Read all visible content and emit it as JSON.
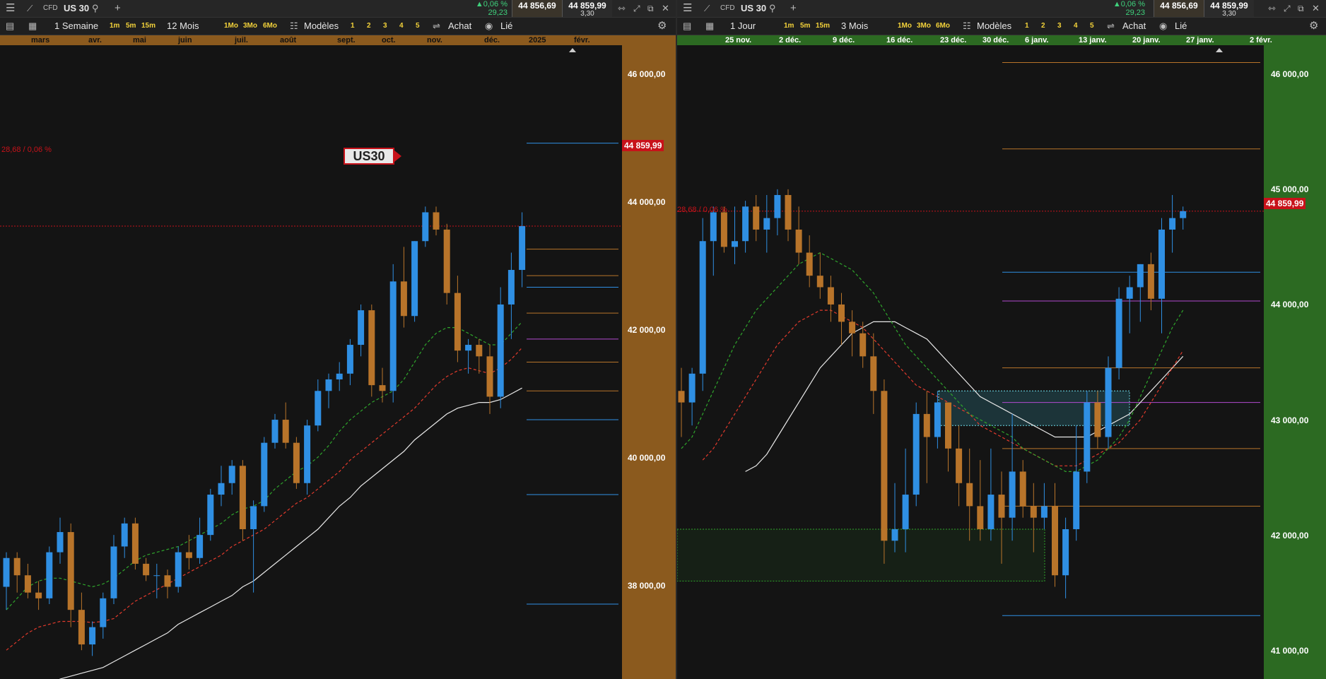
{
  "left": {
    "symbol": "US 30",
    "cfd": "CFD",
    "change_pct": "▲0,06 %",
    "change_abs": "29,23",
    "sell": "44 856,69",
    "buy": "44 859,99",
    "spread": "3,30",
    "toolbar": {
      "interval": "1 Semaine",
      "intervals": [
        "1m",
        "5m",
        "15m"
      ],
      "range": "12 Mois",
      "ranges": [
        "1Mo",
        "3Mo",
        "6Mo"
      ],
      "models": "Modèles",
      "presets": [
        "1",
        "2",
        "3",
        "4",
        "5"
      ],
      "buy_label": "Achat",
      "linked_label": "Lié"
    },
    "time_labels": [
      "mars",
      "avr.",
      "mai",
      "juin",
      "juil.",
      "août",
      "sept.",
      "oct.",
      "nov.",
      "déc.",
      "2025",
      "févr."
    ],
    "price_labels": [
      "46 000,00",
      "44 000,00",
      "42 000,00",
      "40 000,00",
      "38 000,00"
    ],
    "current_price_tag": "44 859,99",
    "change_line_text": "28,68 / 0,06 %",
    "symbol_tag": "US30",
    "axis_color": "#8b5a1e"
  },
  "right": {
    "symbol": "US 30",
    "cfd": "CFD",
    "change_pct": "▲0,06 %",
    "change_abs": "29,23",
    "sell": "44 856,69",
    "buy": "44 859,99",
    "spread": "3,30",
    "toolbar": {
      "interval": "1 Jour",
      "intervals": [
        "1m",
        "5m",
        "15m"
      ],
      "range": "3 Mois",
      "ranges": [
        "1Mo",
        "3Mo",
        "6Mo"
      ],
      "models": "Modèles",
      "presets": [
        "1",
        "2",
        "3",
        "4",
        "5"
      ],
      "buy_label": "Achat",
      "linked_label": "Lié"
    },
    "time_labels": [
      "25 nov.",
      "2 déc.",
      "9 déc.",
      "16 déc.",
      "23 déc.",
      "30 déc.",
      "6 janv.",
      "13 janv.",
      "20 janv.",
      "27 janv.",
      "2 févr."
    ],
    "price_labels": [
      "46 000,00",
      "45 000,00",
      "44 000,00",
      "43 000,00",
      "42 000,00",
      "41 000,00"
    ],
    "current_price_tag": "44 859,99",
    "change_line_text": "28,68 / 0,06 %",
    "axis_color": "#2c6a22"
  },
  "chart_data": [
    {
      "type": "candlestick",
      "interval": "weekly",
      "ylim": [
        37000,
        48000
      ],
      "up_color": "#2f8fe3",
      "down_color": "#b8742a",
      "candles": [
        [
          38600,
          39200,
          38200,
          39100
        ],
        [
          39100,
          39200,
          38500,
          38800
        ],
        [
          38800,
          39000,
          38400,
          38500
        ],
        [
          38500,
          38700,
          38200,
          38400
        ],
        [
          38400,
          39300,
          38300,
          39200
        ],
        [
          39200,
          39800,
          39000,
          39550
        ],
        [
          39550,
          39700,
          37900,
          38200
        ],
        [
          38200,
          38500,
          37500,
          37600
        ],
        [
          37600,
          38000,
          37400,
          37900
        ],
        [
          37900,
          38500,
          37700,
          38400
        ],
        [
          38400,
          39500,
          38300,
          39300
        ],
        [
          39300,
          39800,
          39100,
          39700
        ],
        [
          39700,
          39800,
          38900,
          39000
        ],
        [
          39000,
          39100,
          38700,
          38800
        ],
        [
          38800,
          39000,
          38400,
          38800
        ],
        [
          38800,
          38900,
          38400,
          38600
        ],
        [
          38600,
          39300,
          38500,
          39200
        ],
        [
          39200,
          39500,
          38900,
          39100
        ],
        [
          39100,
          39800,
          39000,
          39500
        ],
        [
          39500,
          40300,
          39400,
          40200
        ],
        [
          40200,
          40700,
          40000,
          40400
        ],
        [
          40400,
          40800,
          40200,
          40700
        ],
        [
          40700,
          40800,
          39400,
          39600
        ],
        [
          39600,
          40100,
          38500,
          40000
        ],
        [
          40000,
          41200,
          39900,
          41100
        ],
        [
          41100,
          41600,
          41000,
          41500
        ],
        [
          41500,
          41800,
          41000,
          41100
        ],
        [
          41100,
          41200,
          40300,
          40400
        ],
        [
          40400,
          41500,
          40200,
          41400
        ],
        [
          41400,
          42200,
          41300,
          42000
        ],
        [
          42000,
          42300,
          41700,
          42200
        ],
        [
          42200,
          42500,
          42000,
          42300
        ],
        [
          42300,
          42900,
          42100,
          42800
        ],
        [
          42800,
          43500,
          42600,
          43400
        ],
        [
          43400,
          43500,
          41900,
          42100
        ],
        [
          42100,
          42400,
          41800,
          42000
        ],
        [
          42000,
          44200,
          41800,
          43900
        ],
        [
          43900,
          44500,
          43100,
          43300
        ],
        [
          43300,
          44600,
          43200,
          44600
        ],
        [
          44600,
          45200,
          44500,
          45100
        ],
        [
          45100,
          45200,
          44700,
          44800
        ],
        [
          44800,
          44900,
          43500,
          43700
        ],
        [
          43700,
          44000,
          42500,
          42700
        ],
        [
          42700,
          42900,
          42300,
          42800
        ],
        [
          42800,
          42900,
          42300,
          42600
        ],
        [
          42600,
          42800,
          41600,
          41900
        ],
        [
          41900,
          43800,
          41700,
          43500
        ],
        [
          43500,
          44400,
          42900,
          44100
        ],
        [
          44100,
          45100,
          43800,
          44860
        ]
      ],
      "ma_green": [
        38200,
        38400,
        38600,
        38700,
        38750,
        38750,
        38700,
        38650,
        38600,
        38650,
        38750,
        38900,
        39050,
        39150,
        39200,
        39250,
        39300,
        39400,
        39500,
        39600,
        39700,
        39850,
        39950,
        40000,
        40100,
        40300,
        40450,
        40600,
        40700,
        40850,
        41050,
        41300,
        41500,
        41650,
        41800,
        41900,
        42000,
        42200,
        42500,
        42800,
        43000,
        43100,
        43100,
        43000,
        42900,
        42800,
        42800,
        43000,
        43200
      ],
      "ma_red": [
        37500,
        37650,
        37800,
        37900,
        37950,
        38000,
        38000,
        38000,
        37980,
        38000,
        38050,
        38200,
        38350,
        38450,
        38550,
        38650,
        38750,
        38850,
        38950,
        39050,
        39150,
        39300,
        39400,
        39500,
        39600,
        39750,
        39900,
        40050,
        40150,
        40300,
        40450,
        40600,
        40800,
        40950,
        41100,
        41250,
        41400,
        41550,
        41700,
        41900,
        42100,
        42250,
        42350,
        42400,
        42350,
        42300,
        42400,
        42550,
        42750
      ],
      "ma_white": [
        36500,
        36600,
        36700,
        36800,
        36900,
        37000,
        37050,
        37100,
        37150,
        37200,
        37300,
        37400,
        37500,
        37600,
        37700,
        37800,
        37950,
        38050,
        38150,
        38250,
        38350,
        38450,
        38600,
        38700,
        38850,
        39000,
        39150,
        39300,
        39450,
        39600,
        39800,
        40000,
        40150,
        40350,
        40500,
        40650,
        40800,
        40950,
        41150,
        41300,
        41450,
        41600,
        41700,
        41750,
        41800,
        41800,
        41850,
        41950,
        42050
      ]
    },
    {
      "type": "candlestick",
      "interval": "daily",
      "ylim": [
        40800,
        46300
      ],
      "up_color": "#2f8fe3",
      "down_color": "#b8742a",
      "candles": [
        [
          43300,
          43500,
          42900,
          43200
        ],
        [
          43200,
          43500,
          43000,
          43450
        ],
        [
          43450,
          44800,
          43300,
          44600
        ],
        [
          44600,
          44900,
          44300,
          44850
        ],
        [
          44850,
          44900,
          44500,
          44550
        ],
        [
          44550,
          44900,
          44400,
          44600
        ],
        [
          44600,
          44950,
          44500,
          44900
        ],
        [
          44900,
          45000,
          44600,
          44700
        ],
        [
          44700,
          45000,
          44500,
          44800
        ],
        [
          44800,
          45050,
          44650,
          45000
        ],
        [
          45000,
          45050,
          44600,
          44700
        ],
        [
          44700,
          44900,
          44400,
          44500
        ],
        [
          44500,
          44650,
          44200,
          44300
        ],
        [
          44300,
          44500,
          44100,
          44200
        ],
        [
          44200,
          44300,
          43900,
          44050
        ],
        [
          44050,
          44150,
          43700,
          43900
        ],
        [
          43900,
          44000,
          43600,
          43800
        ],
        [
          43800,
          43900,
          43500,
          43600
        ],
        [
          43600,
          43800,
          43100,
          43300
        ],
        [
          43300,
          43400,
          41800,
          42000
        ],
        [
          42000,
          42500,
          41900,
          42100
        ],
        [
          42100,
          42800,
          41900,
          42400
        ],
        [
          42400,
          43200,
          42300,
          43100
        ],
        [
          43100,
          43300,
          42500,
          42900
        ],
        [
          42900,
          43300,
          42800,
          43200
        ],
        [
          43200,
          43200,
          42600,
          42800
        ],
        [
          42800,
          43000,
          42300,
          42500
        ],
        [
          42500,
          42800,
          42000,
          42300
        ],
        [
          42300,
          42700,
          42000,
          42100
        ],
        [
          42100,
          42800,
          42000,
          42400
        ],
        [
          42400,
          42600,
          41800,
          42200
        ],
        [
          42200,
          43100,
          42000,
          42600
        ],
        [
          42600,
          42700,
          42200,
          42300
        ],
        [
          42300,
          42500,
          41900,
          42200
        ],
        [
          42200,
          42500,
          42100,
          42300
        ],
        [
          42300,
          42500,
          41600,
          41700
        ],
        [
          41700,
          42200,
          41500,
          42100
        ],
        [
          42100,
          43000,
          42000,
          42600
        ],
        [
          42600,
          43300,
          42500,
          43200
        ],
        [
          43200,
          43300,
          42800,
          42900
        ],
        [
          42900,
          43600,
          42800,
          43500
        ],
        [
          43500,
          44200,
          43400,
          44100
        ],
        [
          44100,
          44300,
          43800,
          44200
        ],
        [
          44200,
          44400,
          43900,
          44400
        ],
        [
          44400,
          44500,
          44000,
          44100
        ],
        [
          44100,
          44800,
          43800,
          44700
        ],
        [
          44700,
          45000,
          44500,
          44800
        ],
        [
          44800,
          44900,
          44700,
          44860
        ]
      ],
      "ma_green": [
        42800,
        42900,
        43100,
        43300,
        43500,
        43700,
        43850,
        44000,
        44100,
        44200,
        44300,
        44400,
        44450,
        44500,
        44450,
        44400,
        44350,
        44250,
        44150,
        44000,
        43850,
        43700,
        43600,
        43500,
        43400,
        43300,
        43200,
        43100,
        43050,
        43000,
        42950,
        42900,
        42800,
        42750,
        42700,
        42650,
        42600,
        42600,
        42650,
        42700,
        42800,
        42900,
        43050,
        43250,
        43450,
        43650,
        43850,
        44000
      ],
      "ma_red": [
        42700,
        42800,
        42950,
        43100,
        43250,
        43400,
        43550,
        43700,
        43800,
        43900,
        43950,
        44000,
        44000,
        43950,
        43900,
        43850,
        43750,
        43650,
        43550,
        43450,
        43350,
        43300,
        43250,
        43200,
        43150,
        43100,
        43000,
        42950,
        42900,
        42850,
        42800,
        42750,
        42700,
        42650,
        42650,
        42650,
        42700,
        42750,
        42800,
        42850,
        42950,
        43050,
        43200,
        43350,
        43500,
        43650
      ],
      "ma_white": [
        42600,
        42650,
        42750,
        42900,
        43050,
        43200,
        43350,
        43500,
        43600,
        43700,
        43800,
        43850,
        43900,
        43900,
        43900,
        43850,
        43800,
        43750,
        43650,
        43550,
        43450,
        43350,
        43250,
        43200,
        43150,
        43100,
        43050,
        43000,
        42950,
        42900,
        42900,
        42900,
        42900,
        42950,
        43000,
        43050,
        43100,
        43200,
        43300,
        43400,
        43500,
        43600
      ]
    }
  ]
}
